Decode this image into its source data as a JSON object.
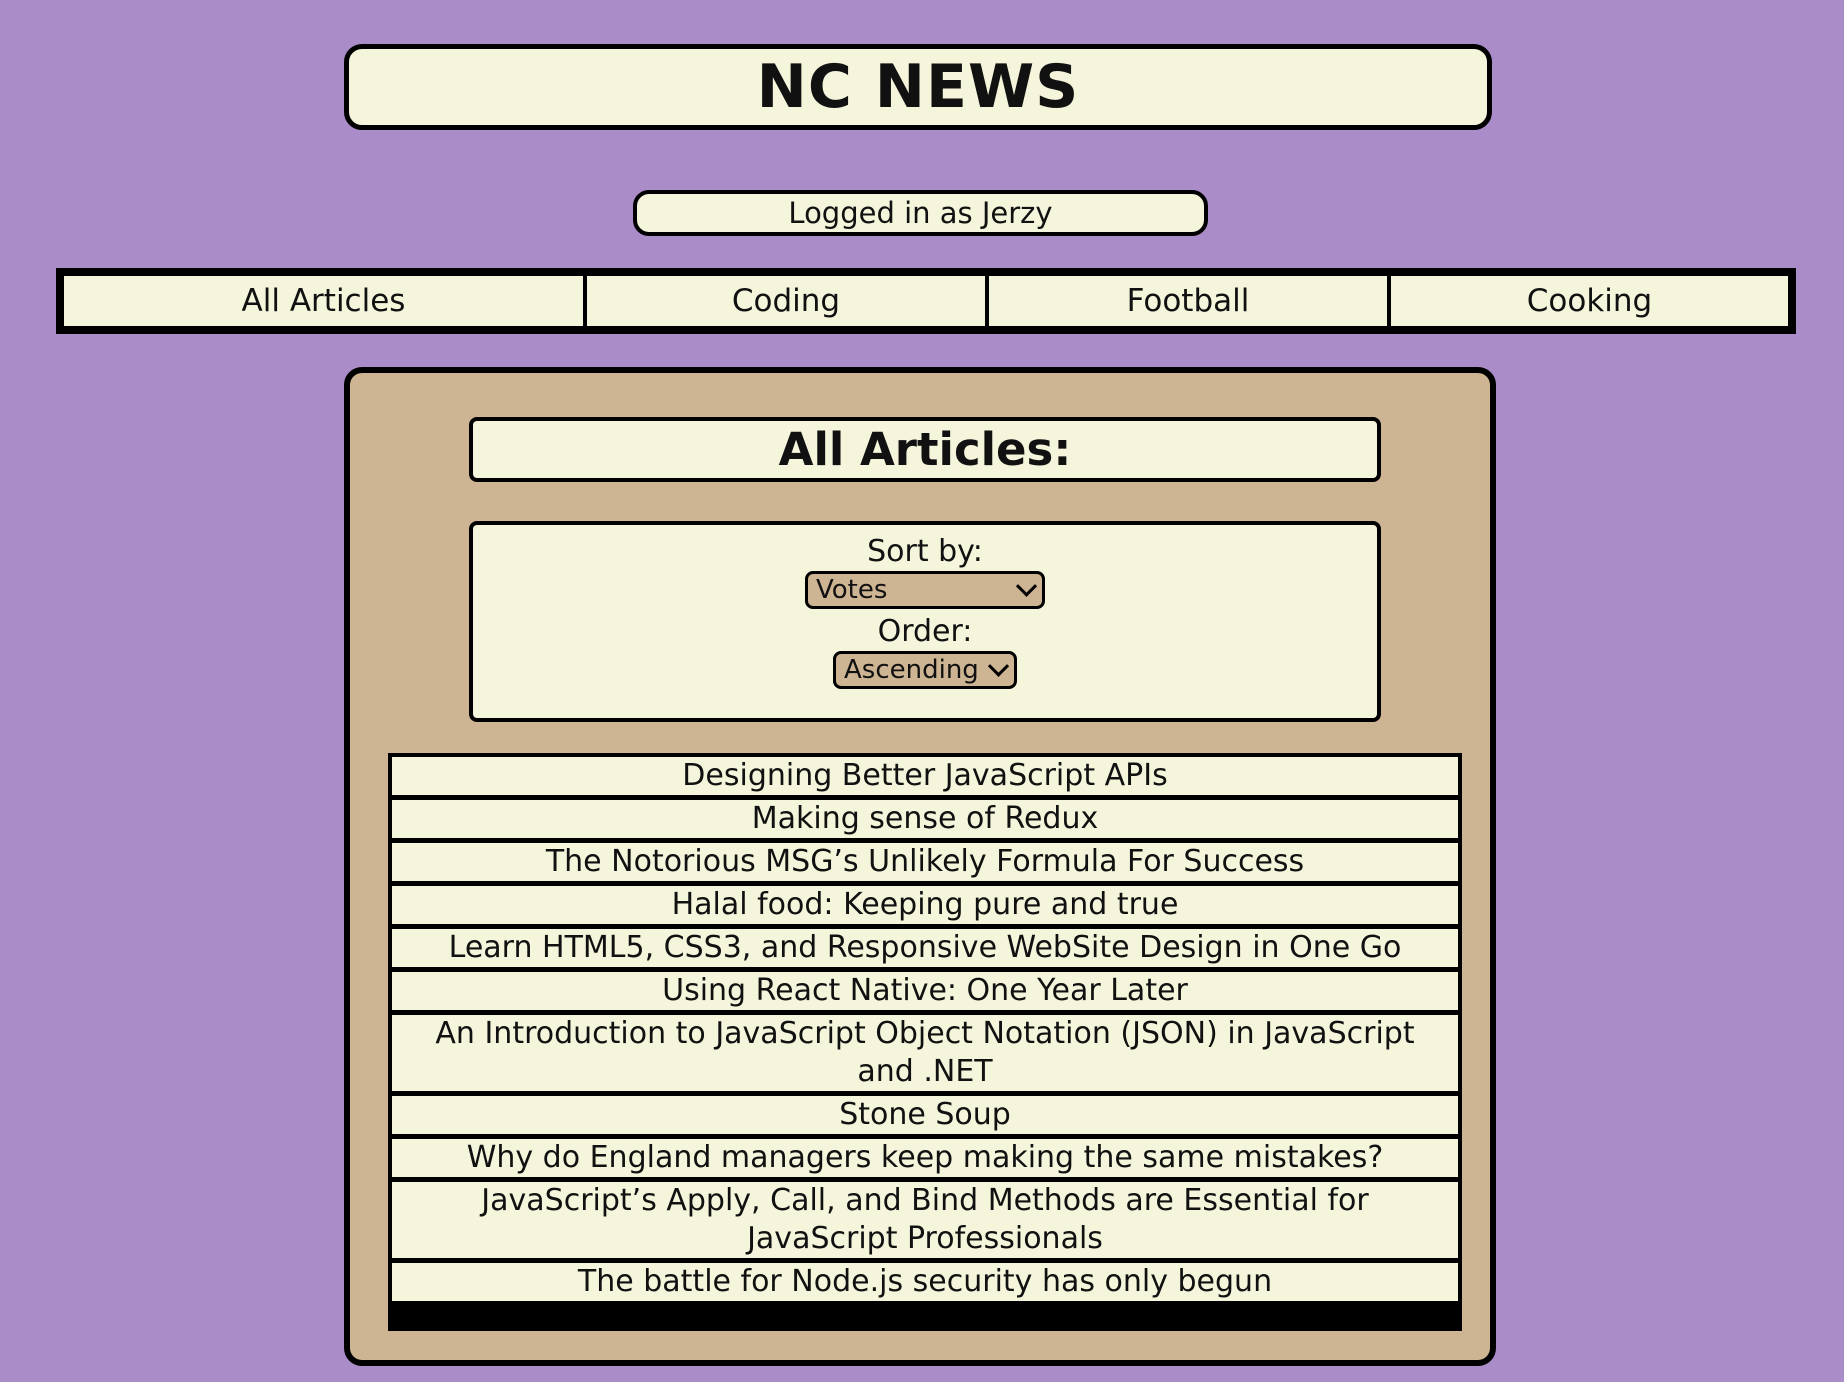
{
  "header": {
    "title": "NC NEWS"
  },
  "user": {
    "status": "Logged in as Jerzy"
  },
  "nav": {
    "items": [
      {
        "label": "All Articles"
      },
      {
        "label": "Coding"
      },
      {
        "label": "Football"
      },
      {
        "label": "Cooking"
      }
    ]
  },
  "panel": {
    "title": "All Articles:",
    "sort_label": "Sort by:",
    "sort_value": "Votes",
    "order_label": "Order:",
    "order_value": "Ascending"
  },
  "articles": [
    {
      "title": "Designing Better JavaScript APIs"
    },
    {
      "title": "Making sense of Redux"
    },
    {
      "title": "The Notorious MSG’s Unlikely Formula For Success"
    },
    {
      "title": "Halal food: Keeping pure and true"
    },
    {
      "title": "Learn HTML5, CSS3, and Responsive WebSite Design in One Go"
    },
    {
      "title": "Using React Native: One Year Later"
    },
    {
      "title": "An Introduction to JavaScript Object Notation (JSON) in JavaScript and .NET"
    },
    {
      "title": "Stone Soup"
    },
    {
      "title": "Why do England managers keep making the same mistakes?"
    },
    {
      "title": "JavaScript’s Apply, Call, and Bind Methods are Essential for JavaScript Professionals"
    },
    {
      "title": "The battle for Node.js security has only begun"
    }
  ],
  "colors": {
    "background": "#aa8dc8",
    "cream": "#f5f5dc",
    "panel": "#cdb492",
    "border": "#000000"
  }
}
